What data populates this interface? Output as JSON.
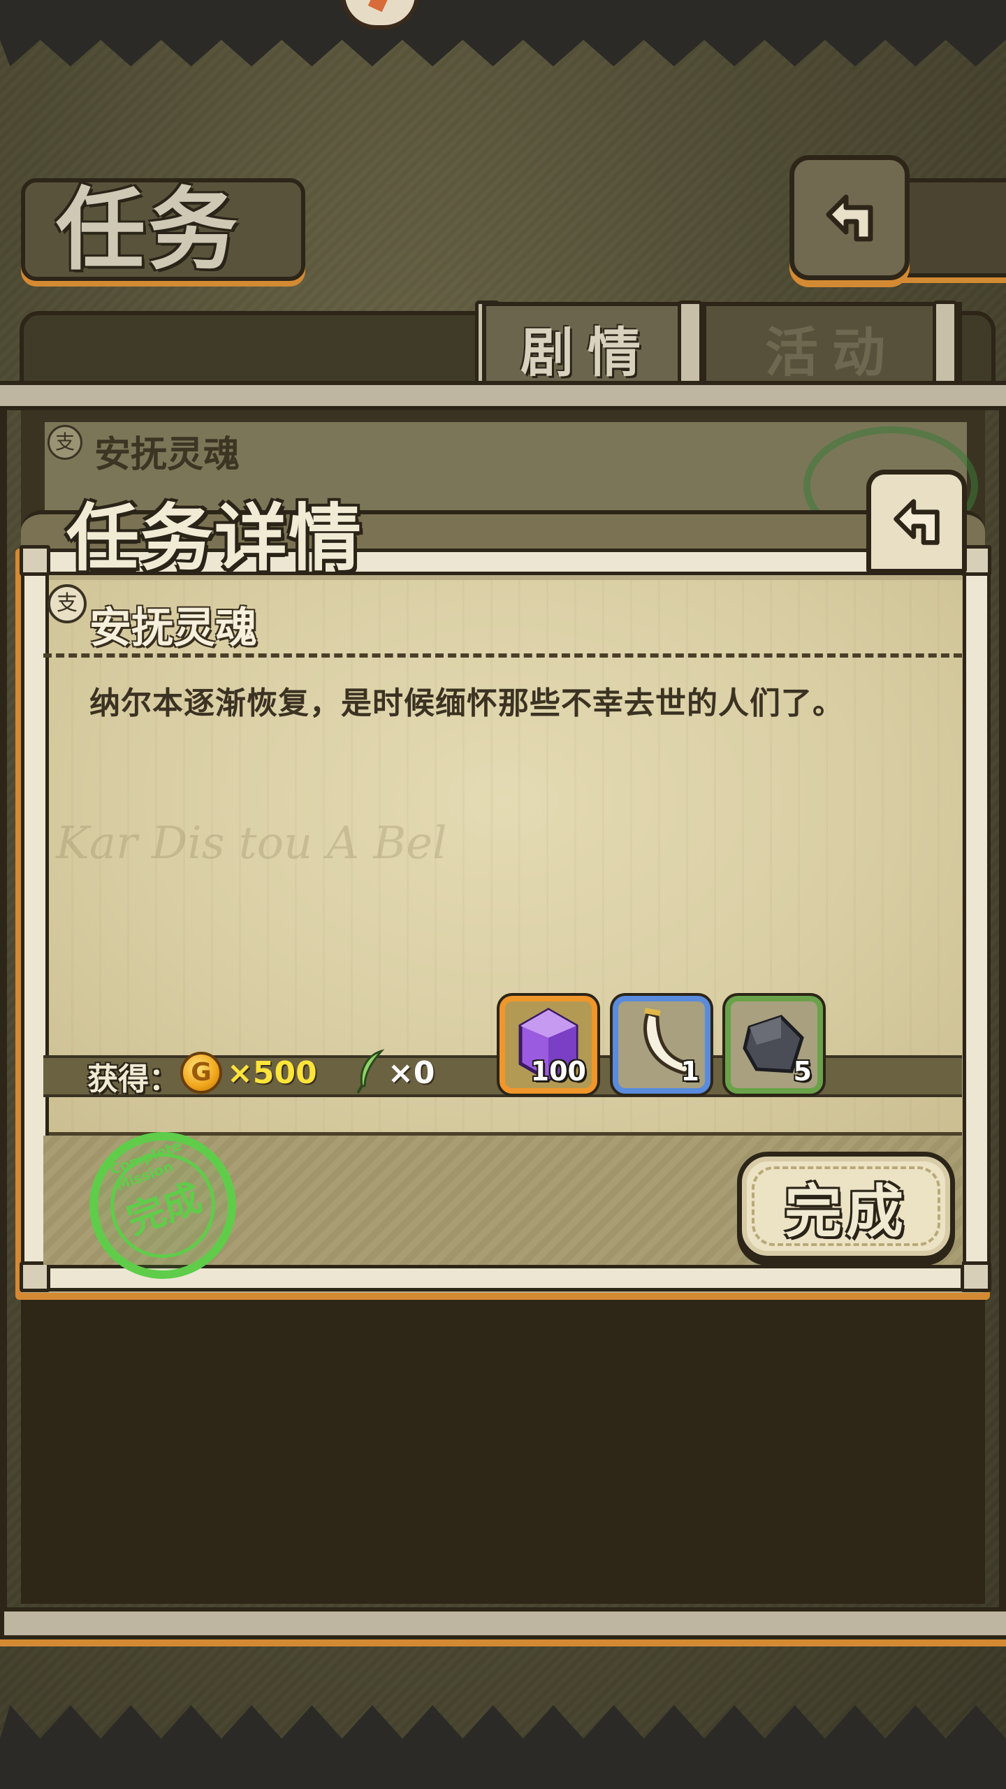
{
  "header": {
    "title": "任务",
    "back_icon": "return-arrow-icon"
  },
  "tabs": [
    {
      "label": "剧情",
      "active": true
    },
    {
      "label": "活动",
      "active": false
    }
  ],
  "list": {
    "items": [
      {
        "title": "安抚灵魂",
        "status_icon": "complete-stamp-icon"
      }
    ]
  },
  "modal": {
    "title": "任务详情",
    "back_icon": "return-arrow-icon",
    "quest_badge": "支",
    "quest_title": "安抚灵魂",
    "description": "纳尔本逐渐恢复，是时候缅怀那些不幸去世的人们了。",
    "watermark": "Kar Dis tou A Bel",
    "reward_label": "获得：",
    "gold_symbol": "G",
    "gold_amount": "×500",
    "feather_amount": "×0",
    "items": [
      {
        "name": "purple-crystal",
        "count": "100",
        "rarity_color": "#f0962a"
      },
      {
        "name": "white-horn",
        "count": "1",
        "rarity_color": "#5a8bdc"
      },
      {
        "name": "dark-stone",
        "count": "5",
        "rarity_color": "#6aa24a"
      }
    ],
    "stamp_text": "完成",
    "stamp_ring": "Complete Mission",
    "complete_button": "完成"
  },
  "colors": {
    "accent_orange": "#d48a33",
    "stamp_green": "#5fcd4a",
    "gold_text": "#ffe43a"
  }
}
